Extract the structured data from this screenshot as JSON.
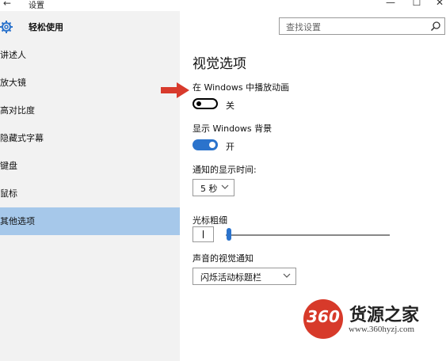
{
  "window": {
    "back_glyph": "←",
    "title": "设置",
    "minimize_glyph": "—",
    "maximize_glyph": "☐",
    "close_glyph": "✕"
  },
  "sidebar": {
    "header": "轻松使用",
    "items": [
      {
        "label": "讲述人",
        "active": false
      },
      {
        "label": "放大镜",
        "active": false
      },
      {
        "label": "高对比度",
        "active": false
      },
      {
        "label": "隐藏式字幕",
        "active": false
      },
      {
        "label": "键盘",
        "active": false
      },
      {
        "label": "鼠标",
        "active": false
      },
      {
        "label": "其他选项",
        "active": true
      }
    ]
  },
  "search": {
    "placeholder": "查找设置"
  },
  "main": {
    "title": "视觉选项",
    "animations": {
      "label": "在 Windows 中播放动画",
      "state": "关",
      "on": false
    },
    "background": {
      "label": "显示 Windows 背景",
      "state": "开",
      "on": true
    },
    "notification_time": {
      "label": "通知的显示时间:",
      "value": "5 秒"
    },
    "cursor_thickness": {
      "label": "光标粗细",
      "value_fraction": 0.0
    },
    "sound_visual": {
      "label": "声音的视觉通知",
      "value": "闪烁活动标题栏"
    }
  },
  "watermark": {
    "badge": "360",
    "name": "货源之家",
    "url": "www.360hyzj.com"
  },
  "colors": {
    "accent": "#2b73cc",
    "active_nav": "#a6c8ea",
    "arrow": "#d83a2c",
    "watermark": "#d73a2a"
  }
}
